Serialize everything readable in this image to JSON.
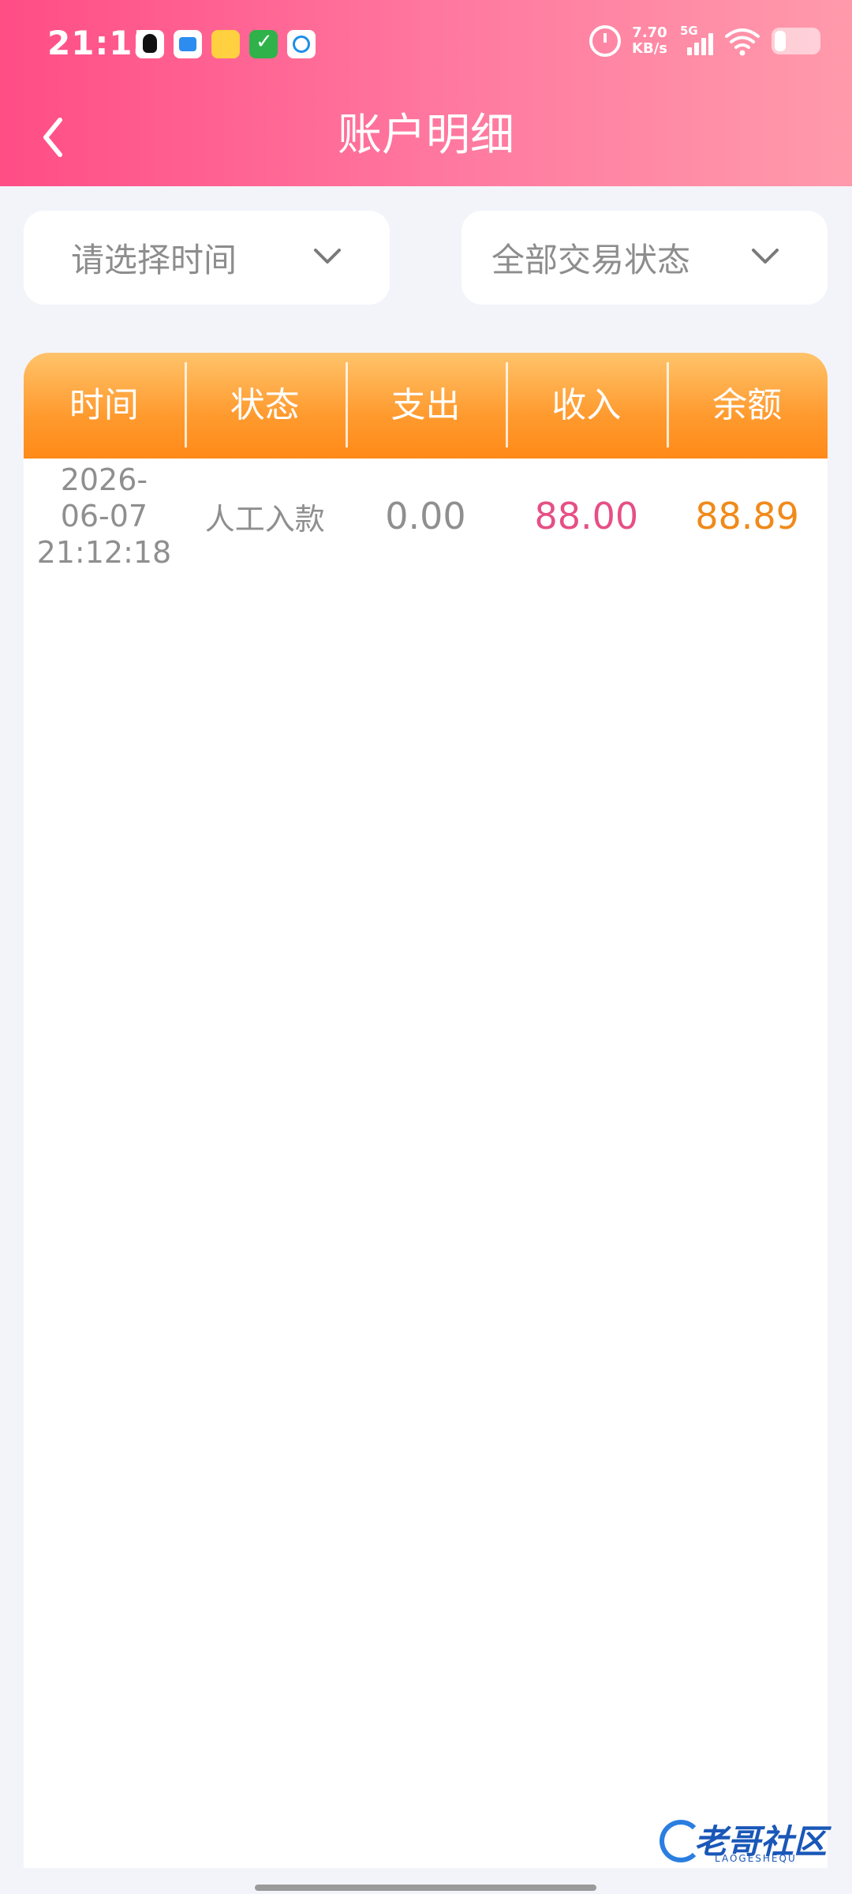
{
  "status_bar": {
    "time": "21:15",
    "net_speed_value": "7.70",
    "net_speed_unit": "KB/s",
    "signal_label": "5G",
    "notification_icons": [
      "qq-icon",
      "messages-icon",
      "notes-icon",
      "tasks-icon",
      "browser-icon"
    ]
  },
  "header": {
    "title": "账户明细",
    "back_icon": "chevron-left-icon"
  },
  "filters": {
    "time_placeholder": "请选择时间",
    "status_value": "全部交易状态"
  },
  "table": {
    "columns": [
      "时间",
      "状态",
      "支出",
      "收入",
      "余额"
    ],
    "rows": [
      {
        "date_line1": "2026-",
        "date_line2": "06-07",
        "date_line3": "21:12:18",
        "status": "人工入款",
        "expense": "0.00",
        "income": "88.00",
        "balance": "88.89"
      }
    ]
  },
  "watermark": {
    "text": "老哥社区",
    "sub": "LAOGESHEQU"
  },
  "colors": {
    "header_gradient_start": "#ff4d86",
    "header_gradient_end": "#ff9aab",
    "table_header": "#ff9a2e",
    "income": "#e64f86",
    "balance": "#f08a1a"
  }
}
